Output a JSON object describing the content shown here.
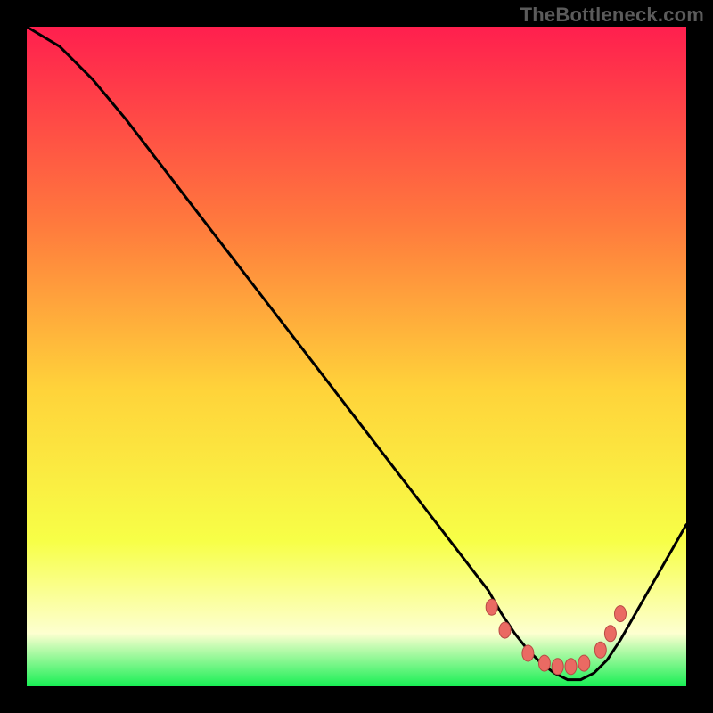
{
  "watermark": "TheBottleneck.com",
  "colors": {
    "bg": "#000000",
    "grad_top": "#ff1f4e",
    "grad_upper_mid": "#ff7a3d",
    "grad_mid": "#ffd33a",
    "grad_lower_mid": "#f7ff47",
    "grad_bottom_pale": "#fdffd0",
    "grad_bottom_green": "#19ef55",
    "curve": "#000000",
    "dot_fill": "#ea6a63",
    "dot_stroke": "#b84a44"
  },
  "chart_data": {
    "type": "line",
    "title": "",
    "xlabel": "",
    "ylabel": "",
    "x": [
      0,
      5,
      10,
      15,
      20,
      25,
      30,
      35,
      40,
      45,
      50,
      55,
      60,
      65,
      70,
      72,
      74,
      76,
      78,
      80,
      82,
      84,
      86,
      88,
      90,
      92,
      94,
      96,
      98,
      100
    ],
    "values": [
      100,
      97,
      92,
      86,
      79.5,
      73,
      66.5,
      60,
      53.5,
      47,
      40.5,
      34,
      27.5,
      21,
      14.5,
      11,
      8,
      5.5,
      3.5,
      2,
      1,
      1,
      2,
      4,
      7,
      10.5,
      14,
      17.5,
      21,
      24.5
    ],
    "ylim": [
      0,
      100
    ],
    "xlim": [
      0,
      100
    ],
    "optimal_range_x": [
      70,
      90
    ],
    "dots": [
      {
        "x": 70.5,
        "y": 12.0
      },
      {
        "x": 72.5,
        "y": 8.5
      },
      {
        "x": 76.0,
        "y": 5.0
      },
      {
        "x": 78.5,
        "y": 3.5
      },
      {
        "x": 80.5,
        "y": 3.0
      },
      {
        "x": 82.5,
        "y": 3.0
      },
      {
        "x": 84.5,
        "y": 3.5
      },
      {
        "x": 87.0,
        "y": 5.5
      },
      {
        "x": 88.5,
        "y": 8.0
      },
      {
        "x": 90.0,
        "y": 11.0
      }
    ]
  }
}
